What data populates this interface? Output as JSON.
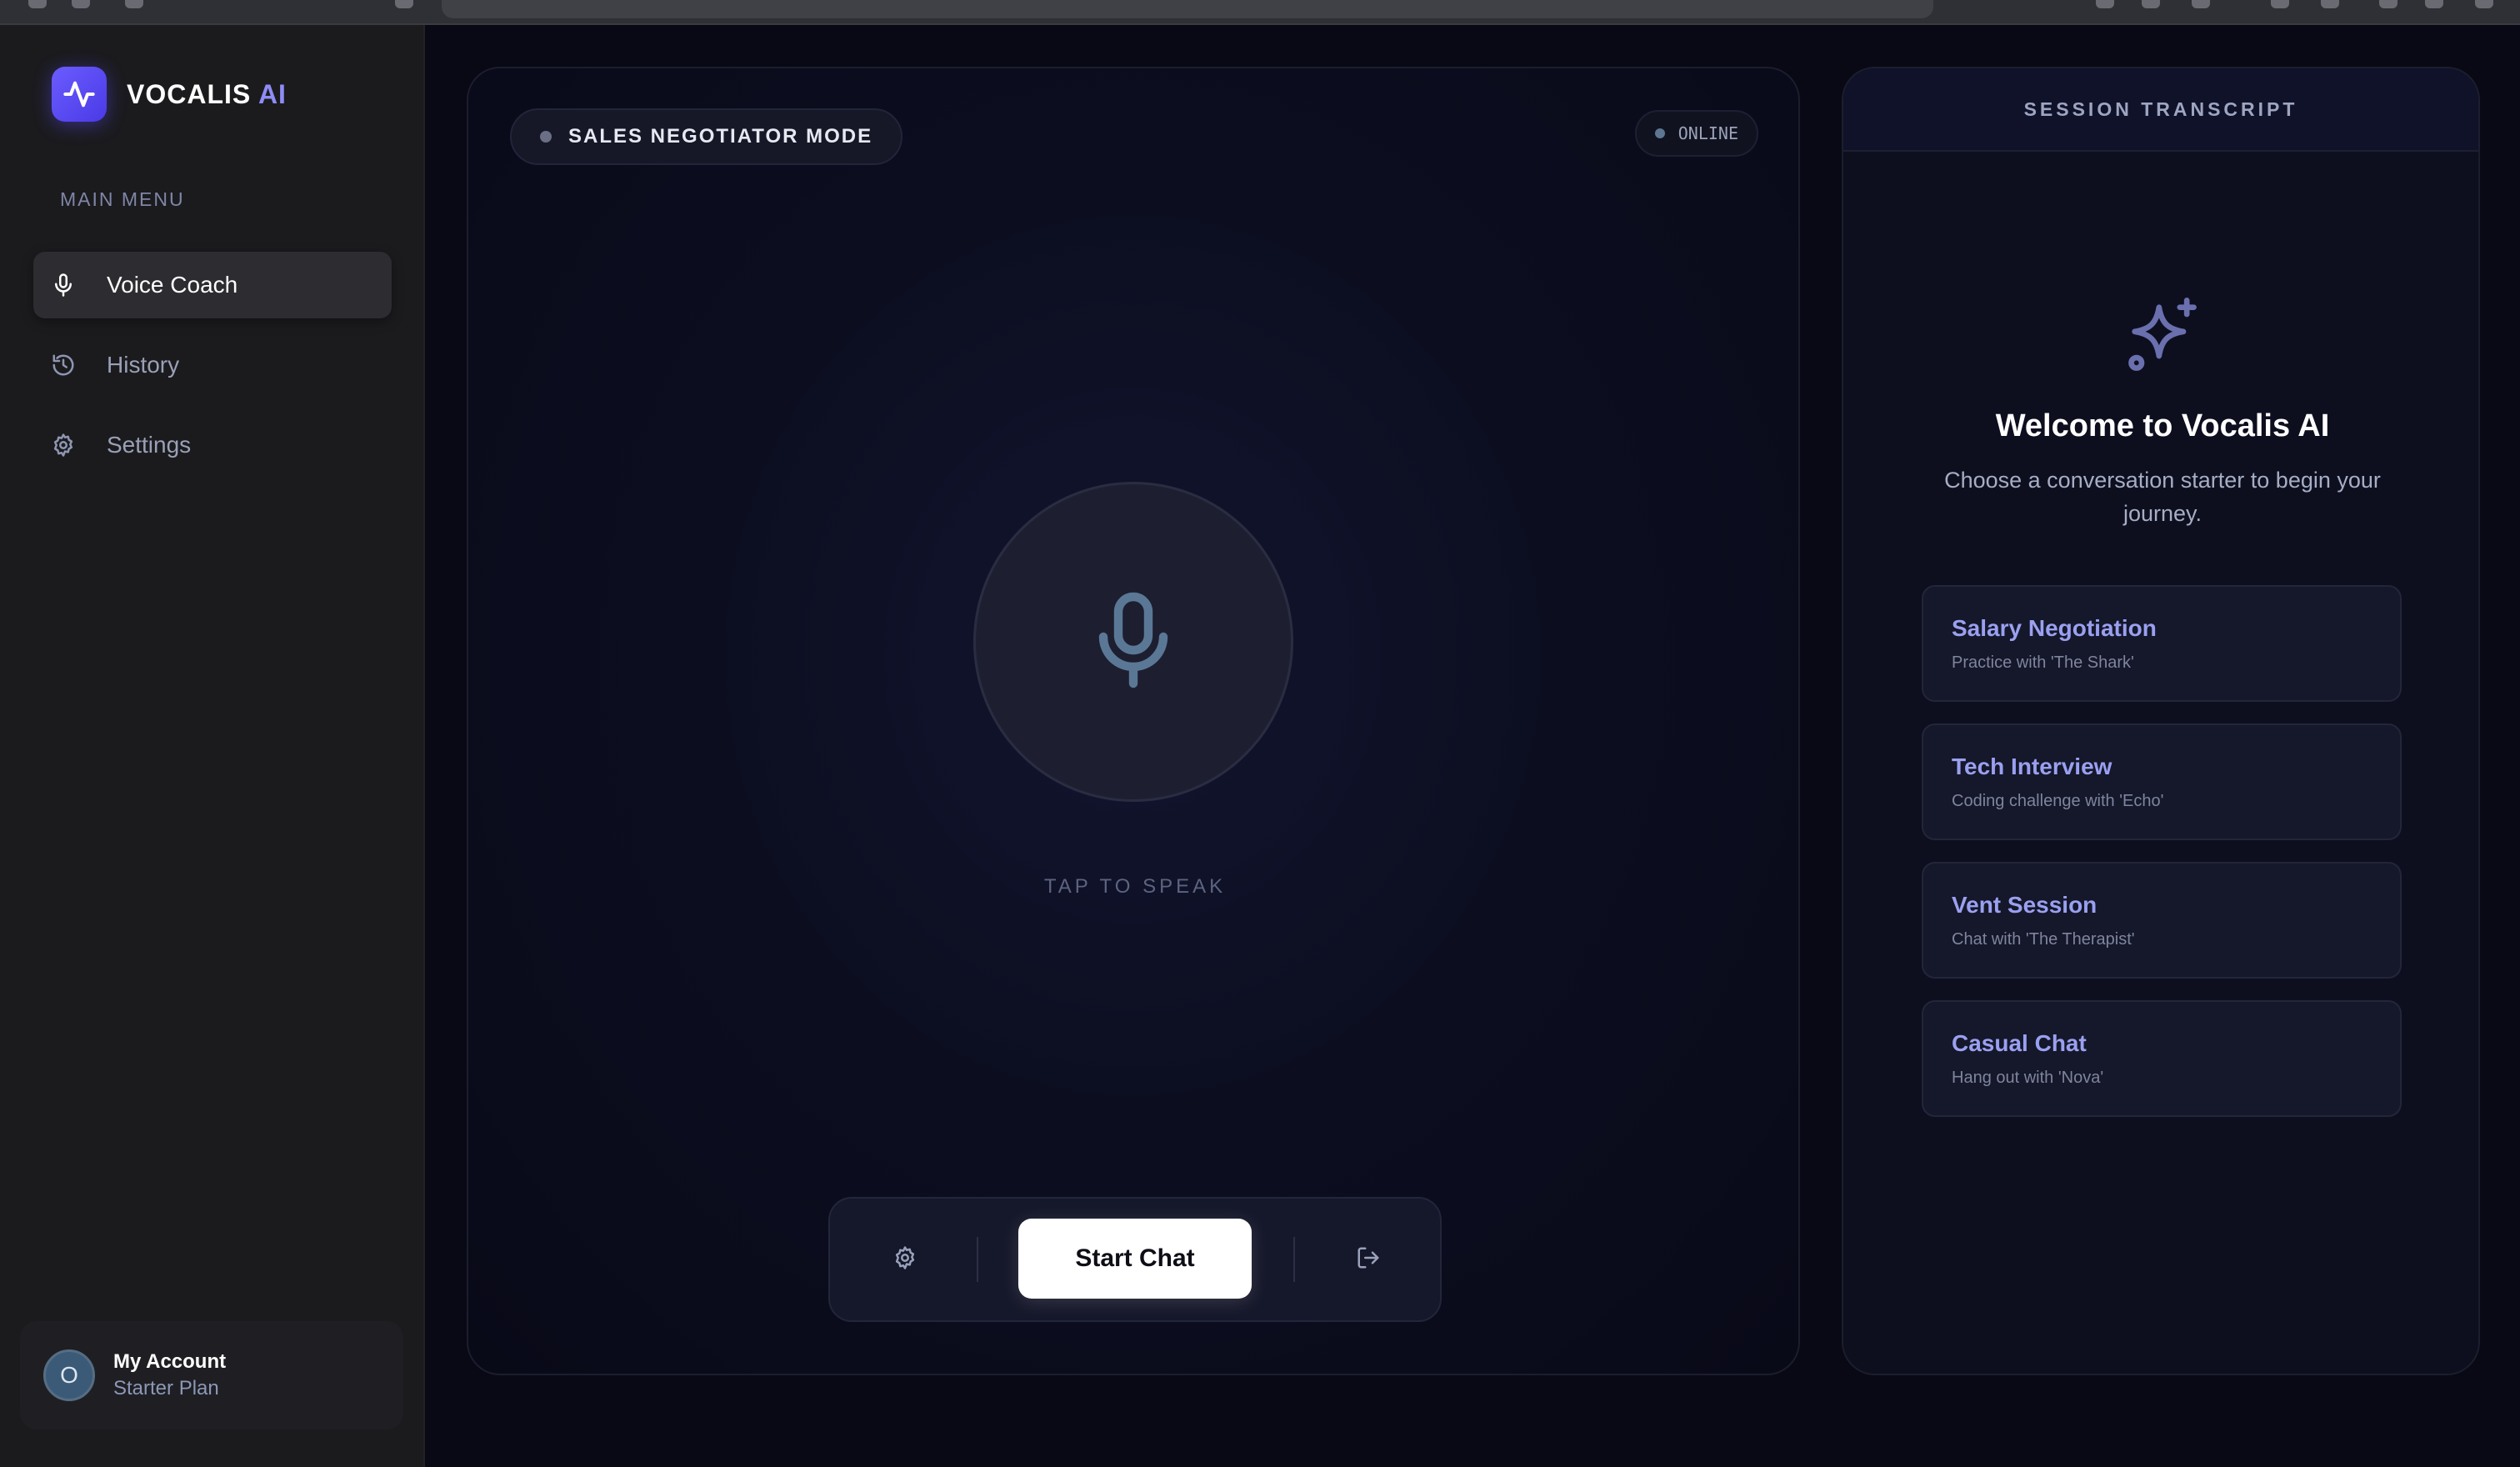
{
  "brand": {
    "name": "VOCALIS",
    "accent": "AI"
  },
  "sidebar": {
    "heading": "MAIN MENU",
    "items": [
      {
        "label": "Voice Coach",
        "icon": "mic-icon",
        "active": true
      },
      {
        "label": "History",
        "icon": "history-icon",
        "active": false
      },
      {
        "label": "Settings",
        "icon": "gear-icon",
        "active": false
      }
    ]
  },
  "account": {
    "initial": "O",
    "name": "My Account",
    "plan": "Starter Plan"
  },
  "main": {
    "mode": "SALES NEGOTIATOR MODE",
    "status": "ONLINE",
    "tap_label": "TAP TO SPEAK",
    "start_label": "Start Chat"
  },
  "transcript": {
    "heading": "SESSION TRANSCRIPT",
    "welcome_title": "Welcome to Vocalis AI",
    "welcome_sub": "Choose a conversation starter to begin your journey.",
    "starters": [
      {
        "title": "Salary Negotiation",
        "desc": "Practice with 'The Shark'"
      },
      {
        "title": "Tech Interview",
        "desc": "Coding challenge with 'Echo'"
      },
      {
        "title": "Vent Session",
        "desc": "Chat with 'The Therapist'"
      },
      {
        "title": "Casual Chat",
        "desc": "Hang out with 'Nova'"
      }
    ]
  },
  "colors": {
    "accent": "#6b5cff",
    "background": "#080914",
    "sidebar": "#1b1b1e",
    "starter_title": "#9aa0f0"
  }
}
